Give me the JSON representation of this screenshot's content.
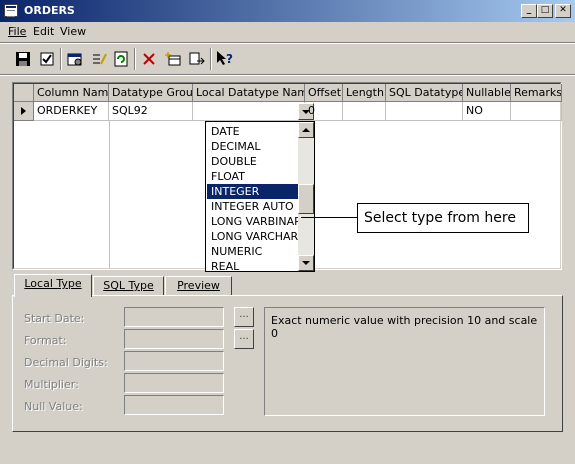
{
  "window": {
    "title": "ORDERS",
    "controls": {
      "minimize": "_",
      "maximize": "□",
      "close": "✕"
    }
  },
  "menu": {
    "items": [
      "File",
      "Edit",
      "View"
    ]
  },
  "toolbar": {
    "icons": [
      "save-icon",
      "check-icon",
      "properties-icon",
      "edit-list-icon",
      "refresh-icon",
      "delete-icon",
      "add-table-icon",
      "export-icon",
      "help-icon"
    ]
  },
  "grid": {
    "columns": [
      "Column Name",
      "Datatype Group",
      "Local Datatype Name",
      "Offset",
      "Length",
      "SQL Datatype",
      "Nullable",
      "Remarks"
    ],
    "rows": [
      {
        "column_name": "ORDERKEY",
        "datatype_group": "SQL92",
        "local_datatype_name": "",
        "offset": "0",
        "length": "",
        "sql_datatype": "",
        "nullable": "NO",
        "remarks": ""
      }
    ]
  },
  "dropdown": {
    "options": [
      "DATE",
      "DECIMAL",
      "DOUBLE",
      "FLOAT",
      "INTEGER",
      "INTEGER AUTO",
      "LONG VARBINAR",
      "LONG VARCHAR",
      "NUMERIC",
      "REAL"
    ],
    "selected": "INTEGER"
  },
  "callout": {
    "text": "Select type from here"
  },
  "tabs": [
    {
      "label": "Local Type",
      "active": true
    },
    {
      "label": "SQL Type",
      "active": false
    },
    {
      "label": "Preview",
      "active": false
    }
  ],
  "form": {
    "start_date_label": "Start Date:",
    "format_label": "Format:",
    "decimal_digits_label": "Decimal Digits:",
    "multiplier_label": "Multiplier:",
    "null_value_label": "Null Value:",
    "ellipsis": "...",
    "description": "Exact numeric value with precision 10 and scale 0"
  },
  "colors": {
    "face": "#d4d0c8",
    "titlebar": "#0a246a",
    "selection": "#0a246a"
  }
}
